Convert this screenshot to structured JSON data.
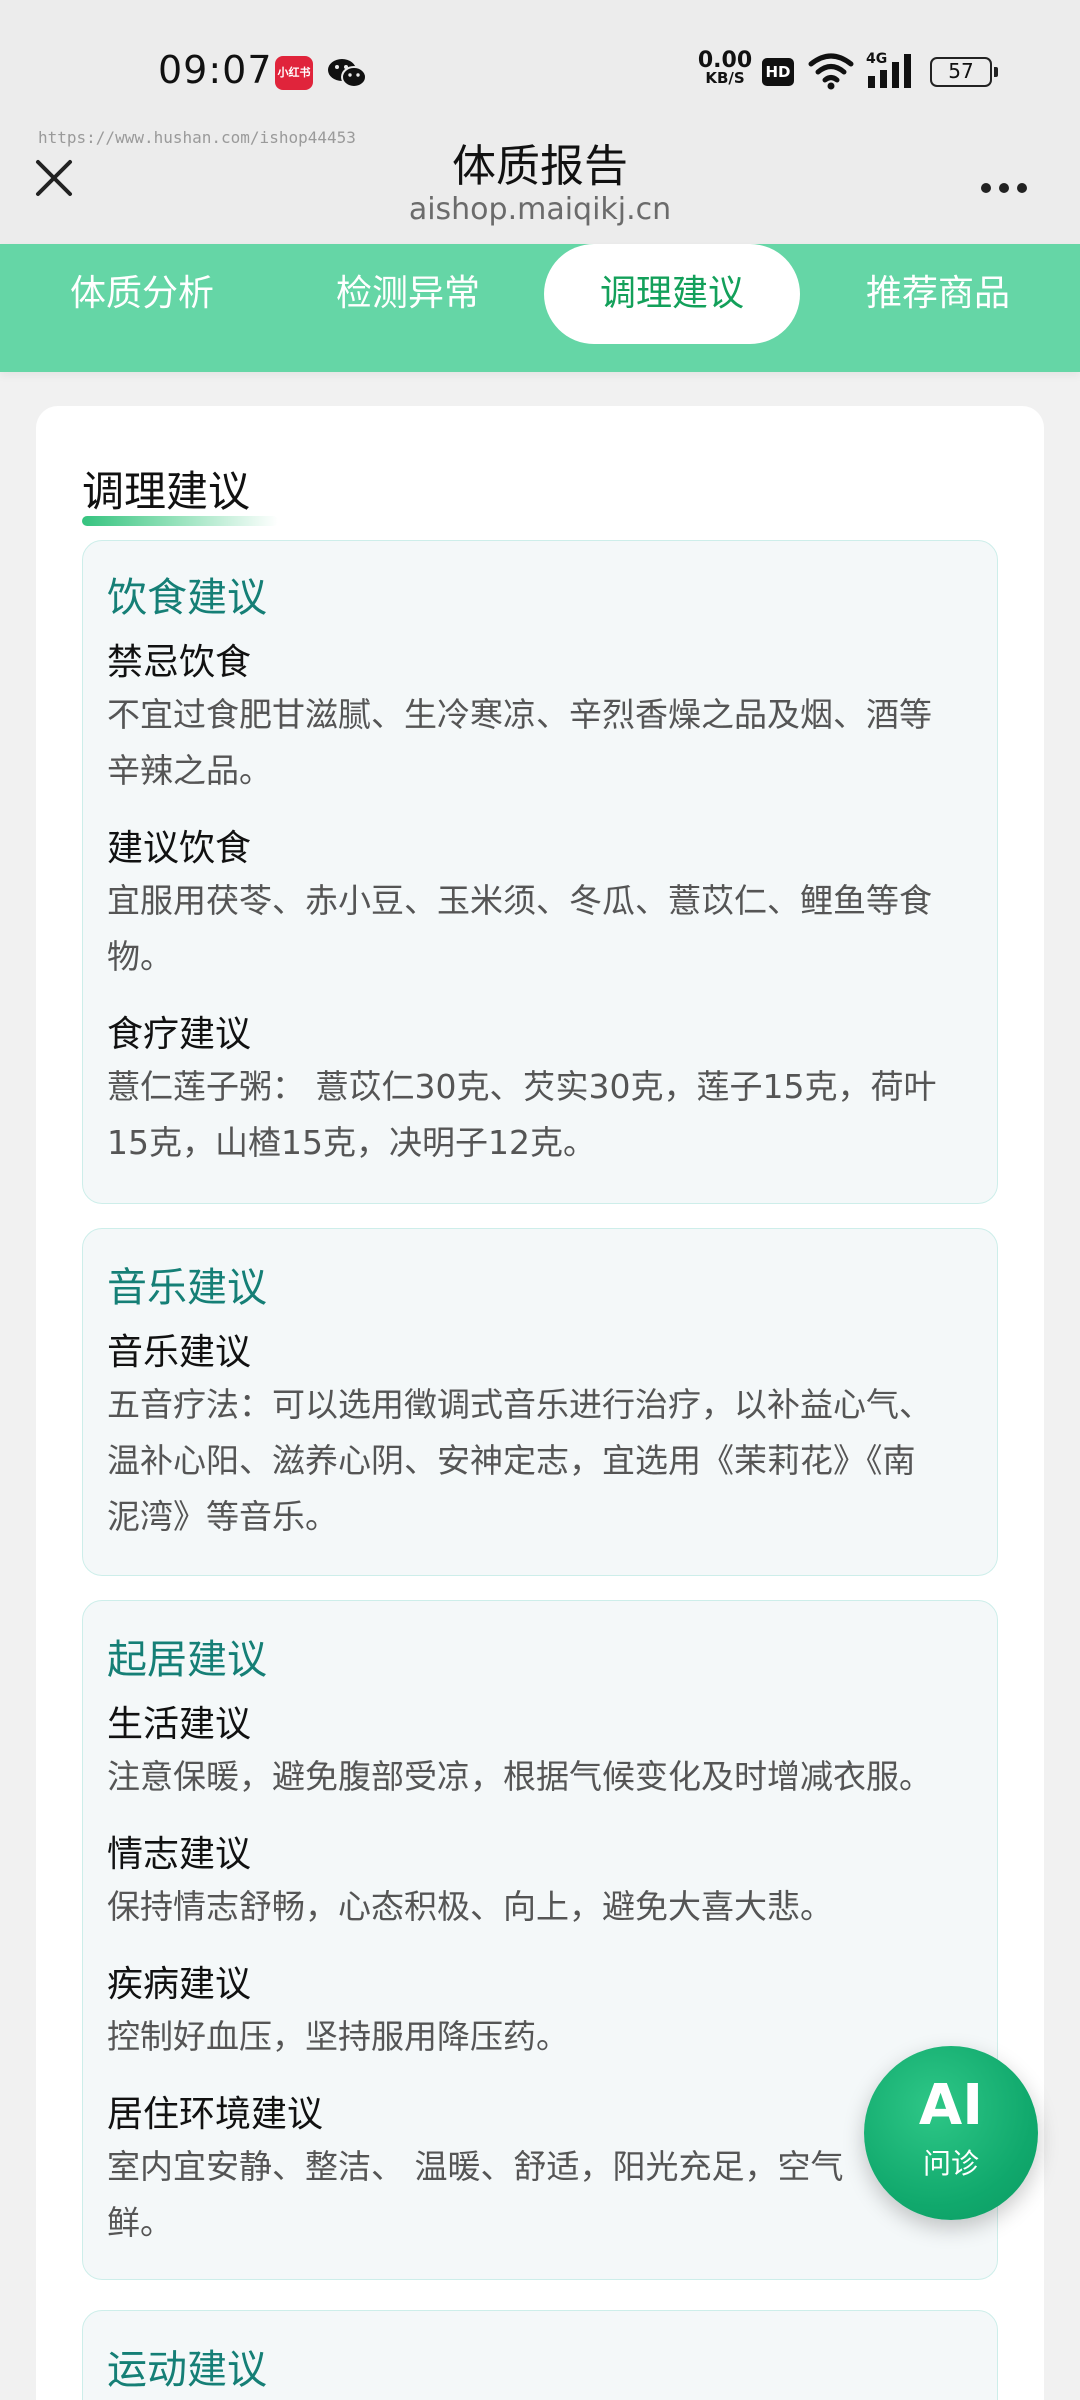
{
  "status_bar": {
    "time": "09:07",
    "app_badge": "小红书",
    "net_speed": "0.00",
    "net_unit": "KB/S",
    "hd": "HD",
    "network": "4G",
    "battery": "57"
  },
  "header": {
    "watermark": "https://www.hushan.com/ishop44453",
    "title": "体质报告",
    "domain": "aishop.maiqikj.cn"
  },
  "tabs": [
    {
      "label": "体质分析",
      "active": false
    },
    {
      "label": "检测异常",
      "active": false
    },
    {
      "label": "调理建议",
      "active": true
    },
    {
      "label": "推荐商品",
      "active": false
    }
  ],
  "main": {
    "heading": "调理建议",
    "cards": [
      {
        "title": "饮食建议",
        "items": [
          {
            "title": "禁忌饮食",
            "lines": [
              "不宜过食肥甘滋腻、生冷寒凉、辛烈香燥之品及烟、酒等",
              "辛辣之品。"
            ]
          },
          {
            "title": "建议饮食",
            "lines": [
              "宜服用茯苓、赤小豆、玉米须、冬瓜、薏苡仁、鲤鱼等食",
              "物。"
            ]
          },
          {
            "title": "食疗建议",
            "lines": [
              "薏仁莲子粥： 薏苡仁30克、芡实30克，莲子15克，荷叶",
              "15克，山楂15克，决明子12克。"
            ]
          }
        ]
      },
      {
        "title": "音乐建议",
        "items": [
          {
            "title": "音乐建议",
            "lines": [
              "五音疗法：可以选用徵调式音乐进行治疗，以补益心气、",
              "温补心阳、滋养心阴、安神定志，宜选用《茉莉花》《南",
              "泥湾》等音乐。"
            ]
          }
        ]
      },
      {
        "title": "起居建议",
        "items": [
          {
            "title": "生活建议",
            "lines": [
              "注意保暖，避免腹部受凉，根据气候变化及时增减衣服。"
            ]
          },
          {
            "title": "情志建议",
            "lines": [
              "保持情志舒畅，心态积极、向上，避免大喜大悲。"
            ]
          },
          {
            "title": "疾病建议",
            "lines": [
              "控制好血压，坚持服用降压药。"
            ]
          },
          {
            "title": "居住环境建议",
            "lines": [
              "室内宜安静、整洁、 温暖、舒适，阳光充足，空气",
              "鲜。"
            ]
          }
        ]
      },
      {
        "title": "运动建议",
        "items": []
      }
    ]
  },
  "ai_button": {
    "big": "AI",
    "small": "问诊"
  }
}
